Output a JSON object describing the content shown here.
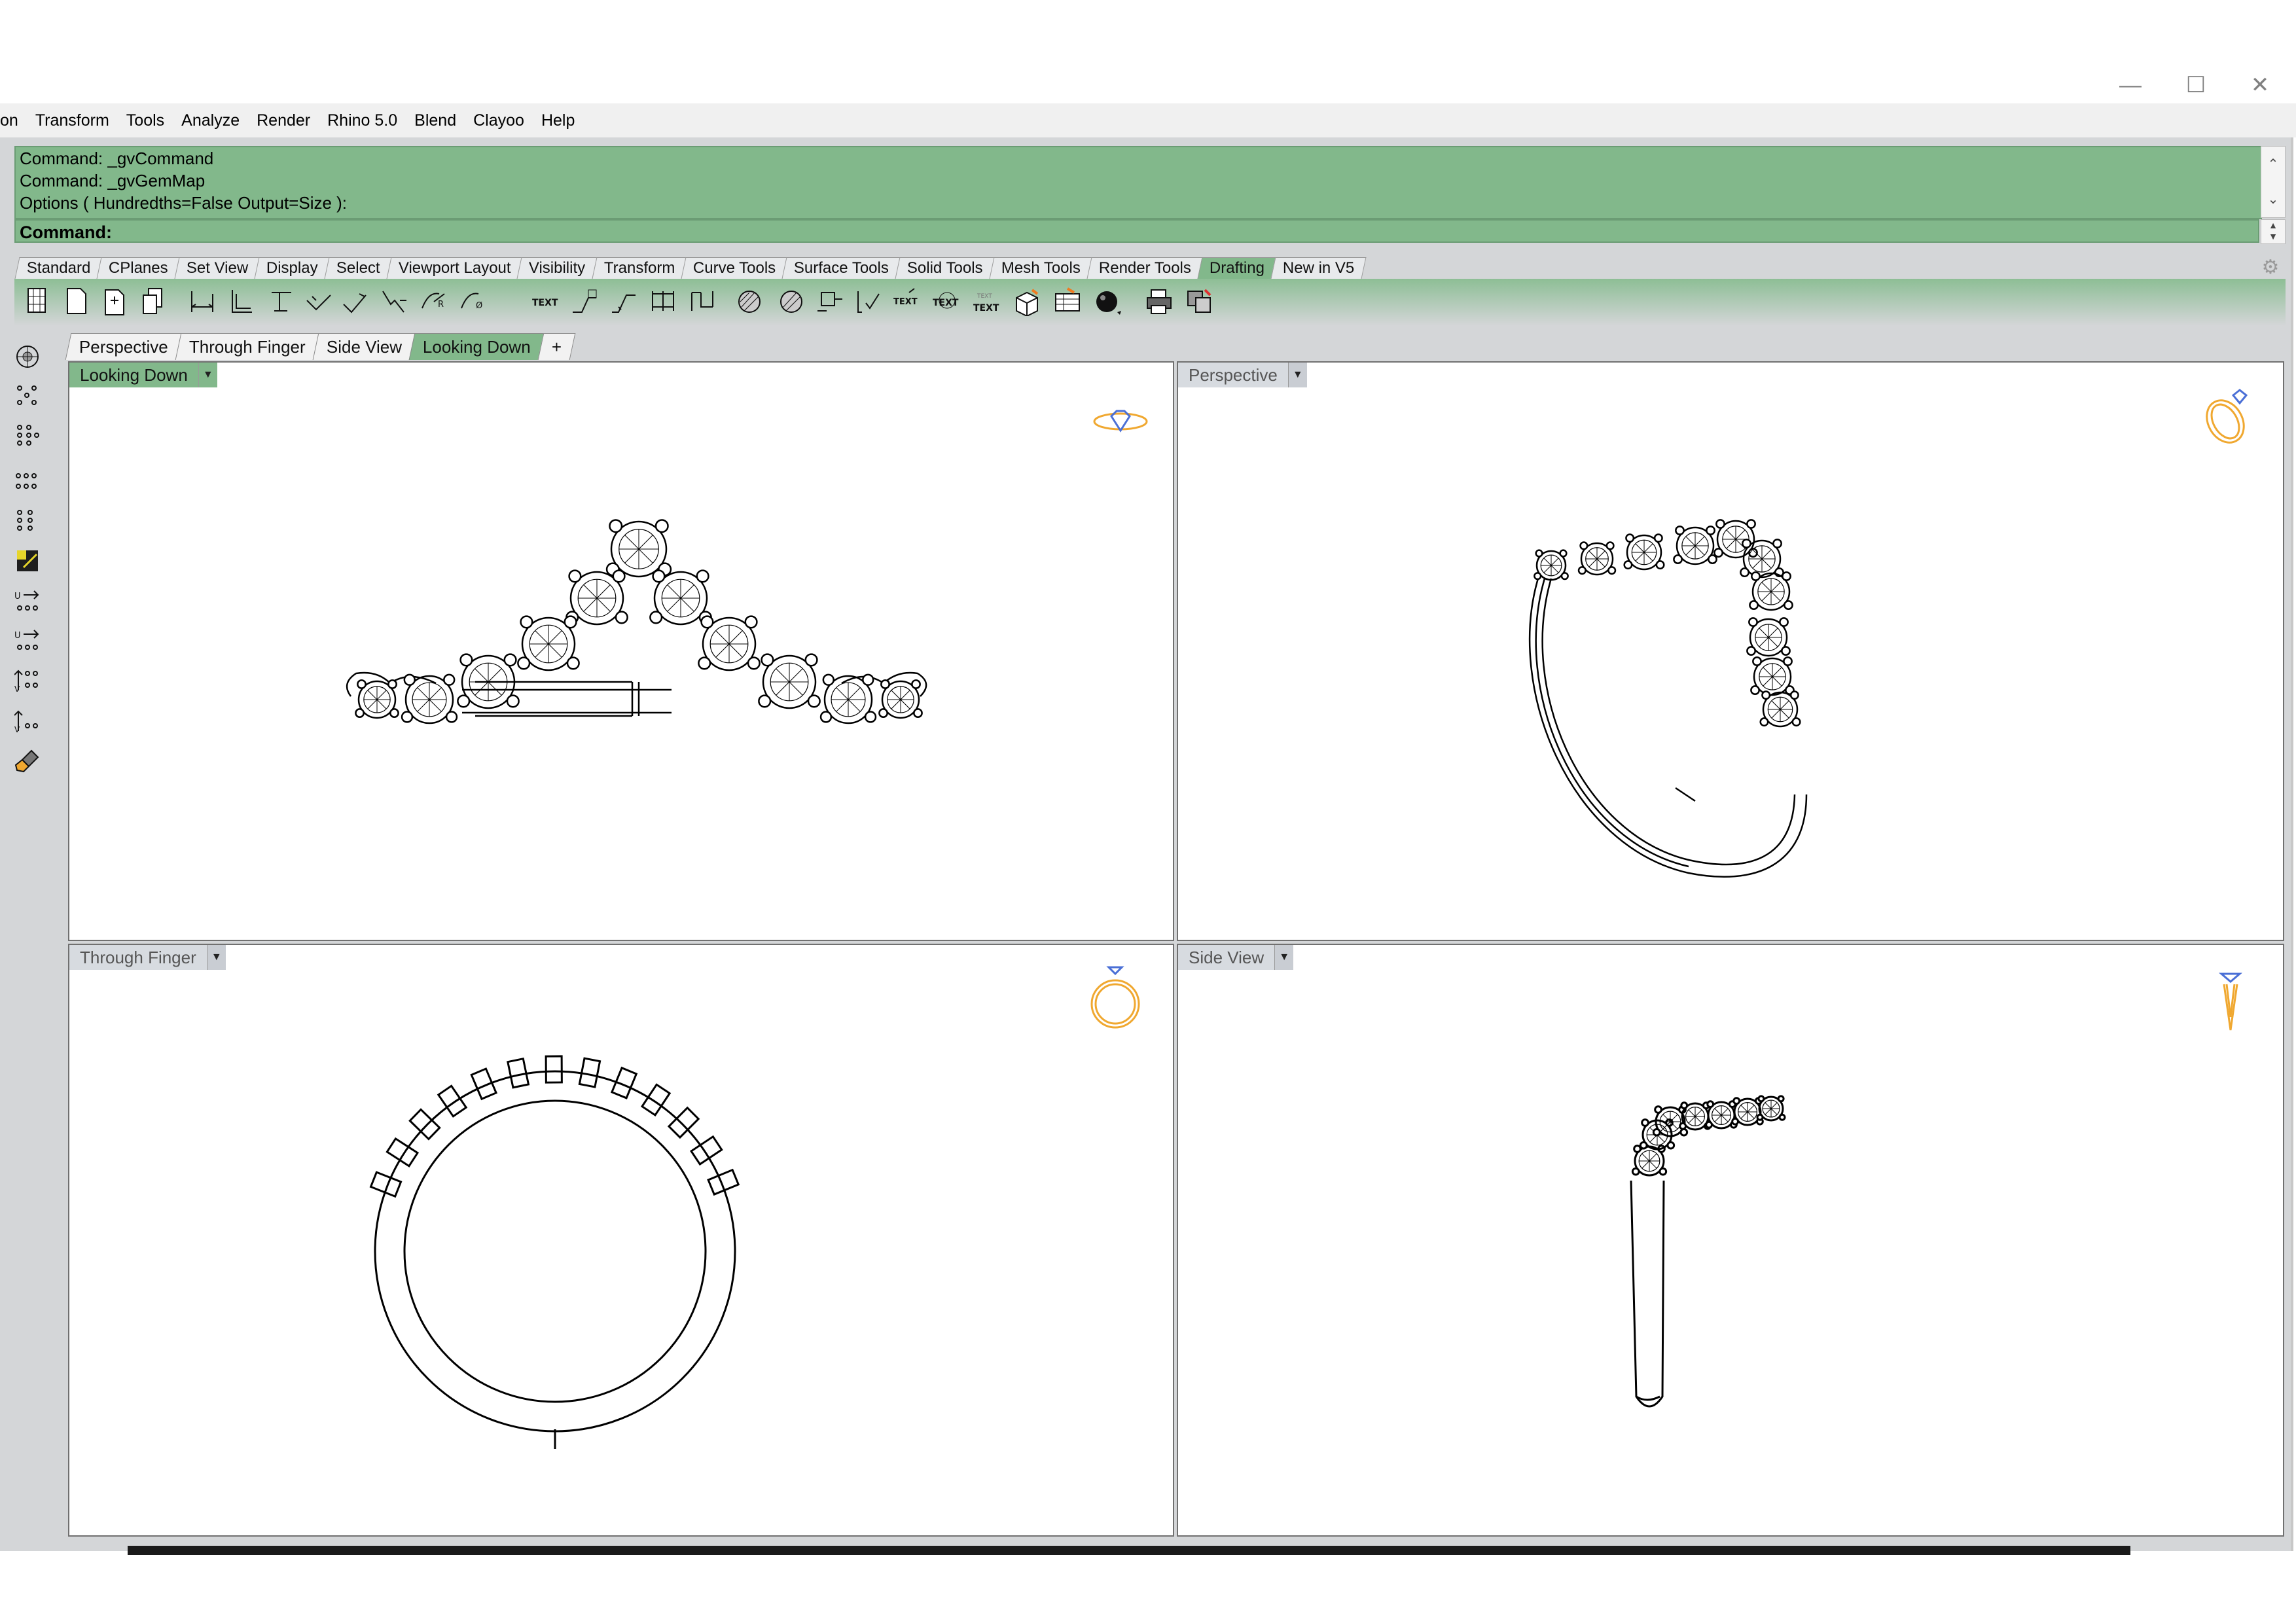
{
  "window": {
    "minimize": "—",
    "maximize": "☐",
    "close": "✕"
  },
  "menu": [
    "on",
    "Transform",
    "Tools",
    "Analyze",
    "Render",
    "Rhino 5.0",
    "Blend",
    "Clayoo",
    "Help"
  ],
  "command_history": [
    "Command: _gvCommand",
    "Command: _gvGemMap",
    "Options ( Hundredths=False  Output=Size ):"
  ],
  "command_prompt": "Command:",
  "toolbar_tabs": [
    {
      "label": "Standard"
    },
    {
      "label": "CPlanes"
    },
    {
      "label": "Set View"
    },
    {
      "label": "Display"
    },
    {
      "label": "Select"
    },
    {
      "label": "Viewport Layout"
    },
    {
      "label": "Visibility"
    },
    {
      "label": "Transform"
    },
    {
      "label": "Curve Tools"
    },
    {
      "label": "Surface Tools"
    },
    {
      "label": "Solid Tools"
    },
    {
      "label": "Mesh Tools"
    },
    {
      "label": "Render Tools"
    },
    {
      "label": "Drafting",
      "active": true
    },
    {
      "label": "New in V5"
    }
  ],
  "toolbar_text_icons": {
    "text1": "TEXT",
    "text2": "TEXT",
    "text3": "TEXT",
    "text4a": "TEXT",
    "text4b": "TEXT"
  },
  "viewport_tabs": [
    {
      "label": "Perspective"
    },
    {
      "label": "Through Finger"
    },
    {
      "label": "Side View"
    },
    {
      "label": "Looking Down",
      "active": true
    },
    {
      "label": "+"
    }
  ],
  "viewports": {
    "looking_down": {
      "label": "Looking Down",
      "active": true
    },
    "perspective": {
      "label": "Perspective"
    },
    "through_finger": {
      "label": "Through Finger"
    },
    "side_view": {
      "label": "Side View"
    }
  },
  "colors": {
    "accent_green": "#82b88b",
    "gizmo_gold": "#f0a830",
    "gizmo_blue": "#4a6fd6"
  }
}
